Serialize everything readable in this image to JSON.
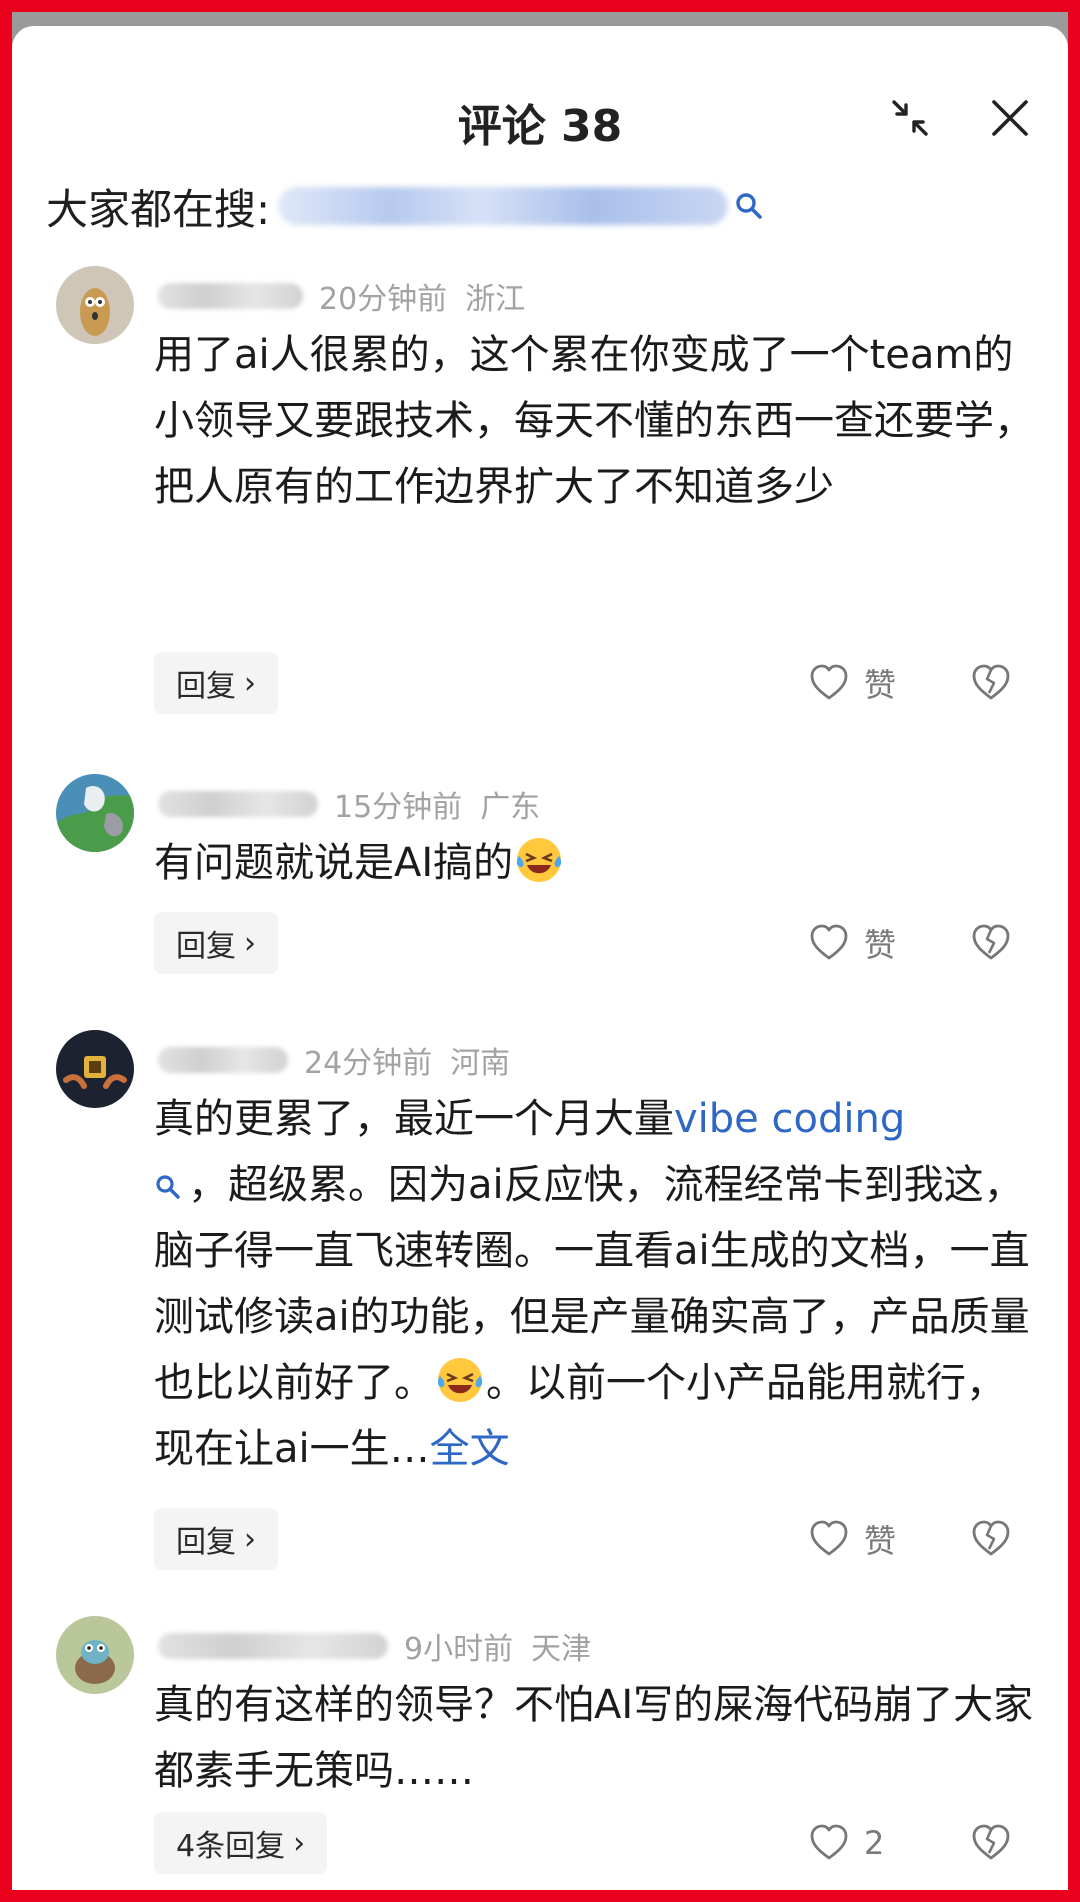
{
  "header": {
    "title": "评论 38"
  },
  "search": {
    "label": "大家都在搜:"
  },
  "comments": [
    {
      "time": "20分钟前",
      "region": "浙江",
      "text": "用了ai人很累的，这个累在你变成了一个team的小领导又要跟技术，每天不懂的东西一查还要学，把人原有的工作边界扩大了不知道多少",
      "reply_label": "回复",
      "like_label": "赞"
    },
    {
      "time": "15分钟前",
      "region": "广东",
      "text": "有问题就说是AI搞的",
      "reply_label": "回复",
      "like_label": "赞"
    },
    {
      "time": "24分钟前",
      "region": "河南",
      "text_before": "真的更累了，最近一个月大量",
      "link_text": "vibe coding",
      "text_after": "，超级累。因为ai反应快，流程经常卡到我这，脑子得一直飞速转圈。一直看ai生成的文档，一直测试修读ai的功能，但是产量确实高了，产品质量也比以前好了。",
      "text_tail": "。以前一个小产品能用就行，现在让ai一生…",
      "more_label": "全文",
      "reply_label": "回复",
      "like_label": "赞"
    },
    {
      "time": "9小时前",
      "region": "天津",
      "text": "真的有这样的领导？不怕AI写的屎海代码崩了大家都素手无策吗……",
      "reply_label": "4条回复",
      "like_label": "2"
    }
  ],
  "icons": {
    "collapse": "collapse-arrows-icon",
    "close": "close-icon",
    "search": "search-icon",
    "like": "heart-outline-icon",
    "dislike": "broken-heart-icon",
    "emoji": "laughing-tears-emoji"
  },
  "colors": {
    "frame": "#e8001c",
    "link": "#2f67c4",
    "meta": "#a2a2a2"
  }
}
